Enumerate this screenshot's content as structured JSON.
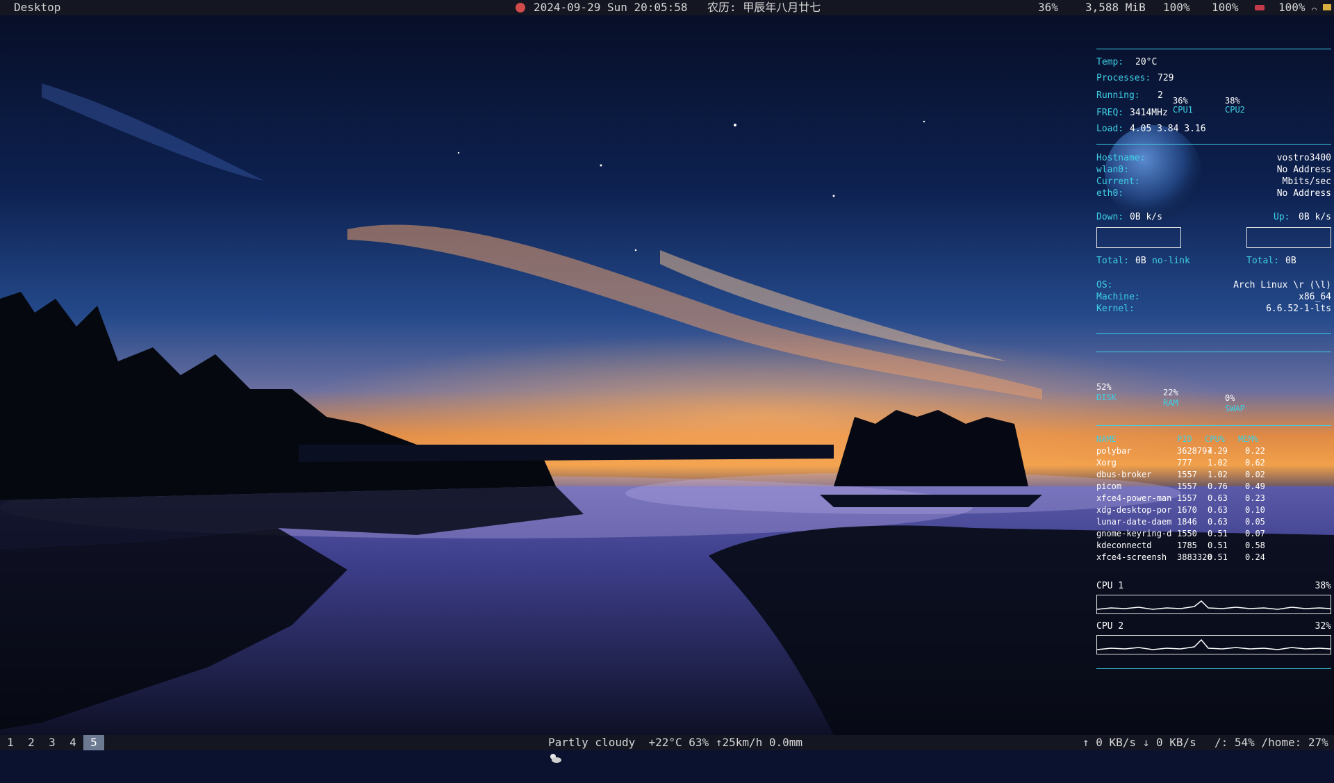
{
  "topbar": {
    "workspace_title": "Desktop",
    "datetime": "2024-09-29 Sun 20:05:58",
    "lunar": "农历: 甲辰年八月廿七",
    "cpu": "36%",
    "mem": "3,588 MiB",
    "vol1": "100%",
    "vol2": "100%",
    "battery": "100%"
  },
  "bottombar": {
    "workspaces": [
      "1",
      "2",
      "3",
      "4",
      "5"
    ],
    "active_workspace": "5",
    "weather": "Partly cloudy  +22°C 63% ↑25km/h 0.0mm",
    "net": "↑ 0 KB/s ↓ 0 KB/s",
    "disk": "/: 54% /home: 27%"
  },
  "conky": {
    "system": {
      "temp_label": "Temp:",
      "temp_value": "20°C",
      "processes_label": "Processes:",
      "processes_value": "729",
      "running_label": "Running:",
      "running_value": "2",
      "freq_label": "FREQ:",
      "freq_value": "3414MHz",
      "load_label": "Load:",
      "load_value": "4.05 3.84 3.16",
      "cpu1_pct": "36%",
      "cpu1_label": "CPU1",
      "cpu2_pct": "38%",
      "cpu2_label": "CPU2"
    },
    "network": {
      "hostname_label": "Hostname:",
      "hostname_value": "vostro3400",
      "wlan_label": "wlan0:",
      "wlan_value": "No Address",
      "current_label": "Current:",
      "current_value": "Mbits/sec",
      "eth_label": "eth0:",
      "eth_value": "No Address",
      "down_label": "Down:",
      "down_value": "0B k/s",
      "up_label": "Up:",
      "up_value": "0B k/s",
      "total_down_label": "Total:",
      "total_down_value": "0B",
      "total_down_extra": "no-link",
      "total_up_label": "Total:",
      "total_up_value": "0B"
    },
    "os_info": {
      "os_label": "OS:",
      "os_value": "Arch Linux \\r (\\l)",
      "machine_label": "Machine:",
      "machine_value": "x86_64",
      "kernel_label": "Kernel:",
      "kernel_value": "6.6.52-1-lts"
    },
    "usage": {
      "disk_pct": "52%",
      "disk_label": "DISK",
      "ram_pct": "22%",
      "ram_label": "RAM",
      "swap_pct": "0%",
      "swap_label": "SWAP"
    },
    "process_table": {
      "headers": [
        "NAME",
        "PID",
        "CPU%",
        "MEM%"
      ],
      "rows": [
        [
          "polybar",
          "3628797",
          "4.29",
          "0.22"
        ],
        [
          "Xorg",
          "777",
          "1.02",
          "0.62"
        ],
        [
          "dbus-broker",
          "1557",
          "1.02",
          "0.02"
        ],
        [
          "picom",
          "1557",
          "0.76",
          "0.49"
        ],
        [
          "xfce4-power-man",
          "1557",
          "0.63",
          "0.23"
        ],
        [
          "xdg-desktop-por",
          "1670",
          "0.63",
          "0.10"
        ],
        [
          "lunar-date-daem",
          "1846",
          "0.63",
          "0.05"
        ],
        [
          "gnome-keyring-d",
          "1550",
          "0.51",
          "0.07"
        ],
        [
          "kdeconnectd",
          "1785",
          "0.51",
          "0.58"
        ],
        [
          "xfce4-screensh",
          "3883320",
          "0.51",
          "0.24"
        ]
      ]
    },
    "cpu_graphs": {
      "cpu1_label": "CPU 1",
      "cpu1_value": "38%",
      "cpu2_label": "CPU 2",
      "cpu2_value": "32%"
    }
  },
  "colors": {
    "bar_bg": "#141622",
    "conky_accent": "#3fd0e6",
    "active_workspace": "#6c7a92"
  }
}
